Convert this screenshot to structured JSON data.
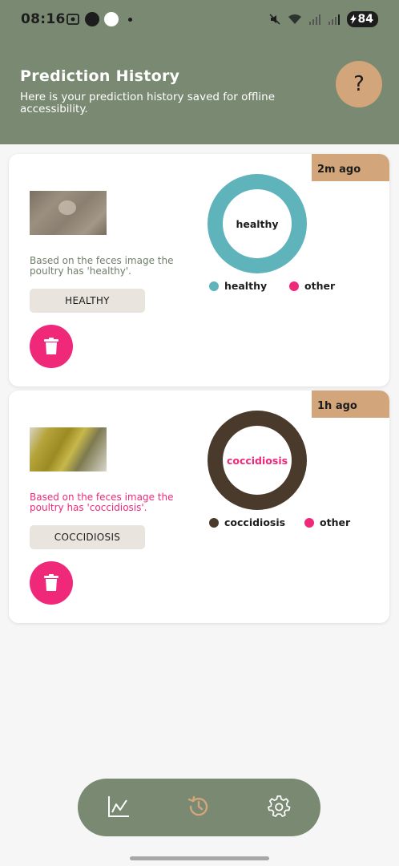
{
  "status_bar": {
    "time": "08:16",
    "battery": "84"
  },
  "header": {
    "title": "Prediction History",
    "subtitle": "Here is your prediction history saved for offline accessibility.",
    "help_label": "?"
  },
  "colors": {
    "header_bg": "#7a8a72",
    "accent_tan": "#d2a57a",
    "delete_pink": "#f0287a",
    "healthy_teal": "#5fb3bb",
    "coccidiosis_brown": "#4a3a2c"
  },
  "predictions": [
    {
      "time_ago": "2m ago",
      "description": "Based on the feces image the poultry has 'healthy'.",
      "label": "HEALTHY",
      "chart_center": "healthy",
      "legend": [
        "healthy",
        "other"
      ],
      "delete_icon": "trash-icon"
    },
    {
      "time_ago": "1h ago",
      "description": "Based on the feces image the poultry has 'coccidiosis'.",
      "label": "COCCIDIOSIS",
      "chart_center": "coccidiosis",
      "legend": [
        "coccidiosis",
        "other"
      ],
      "delete_icon": "trash-icon"
    }
  ],
  "bottom_nav": {
    "items": [
      "chart-icon",
      "history-icon",
      "settings-icon"
    ],
    "active": "history-icon"
  }
}
